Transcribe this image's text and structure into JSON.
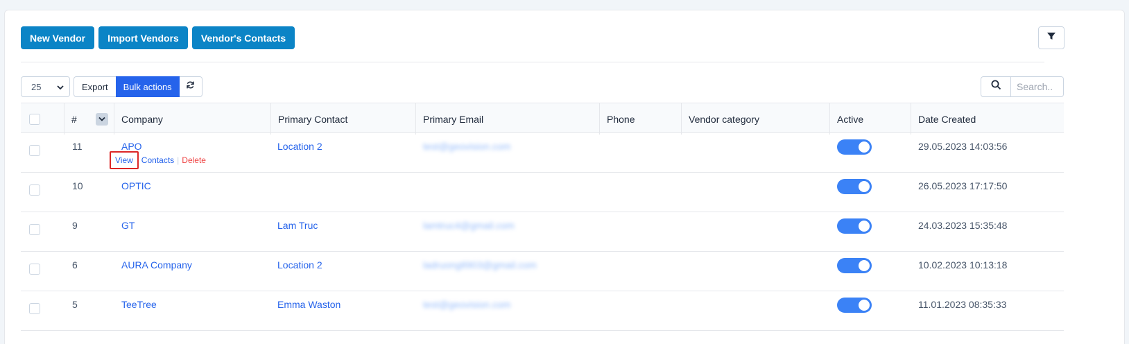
{
  "toolbar": {
    "new_vendor": "New Vendor",
    "import_vendors": "Import Vendors",
    "vendors_contacts": "Vendor's Contacts",
    "filter_icon": "filter-icon"
  },
  "table_controls": {
    "page_size": "25",
    "export": "Export",
    "bulk_actions": "Bulk actions",
    "reload_icon": "refresh-icon",
    "search_placeholder": "Search.."
  },
  "columns": {
    "num": "#",
    "company": "Company",
    "primary_contact": "Primary Contact",
    "primary_email": "Primary Email",
    "phone": "Phone",
    "vendor_category": "Vendor category",
    "active": "Active",
    "date_created": "Date Created"
  },
  "row_actions": {
    "view": "View",
    "contacts": "Contacts",
    "delete": "Delete"
  },
  "rows": [
    {
      "id": "11",
      "company": "APO",
      "contact": "Location 2",
      "email": "test@geovision.com",
      "phone": "",
      "category": "",
      "active": true,
      "date": "29.05.2023 14:03:56"
    },
    {
      "id": "10",
      "company": "OPTIC",
      "contact": "",
      "email": "",
      "phone": "",
      "category": "",
      "active": true,
      "date": "26.05.2023 17:17:50"
    },
    {
      "id": "9",
      "company": "GT",
      "contact": "Lam Truc",
      "email": "lamtruc4@gmail.com",
      "phone": "",
      "category": "",
      "active": true,
      "date": "24.03.2023 15:35:48"
    },
    {
      "id": "6",
      "company": "AURA Company",
      "contact": "Location 2",
      "email": "ladruong8903@gmail.com",
      "phone": "",
      "category": "",
      "active": true,
      "date": "10.02.2023 10:13:18"
    },
    {
      "id": "5",
      "company": "TeeTree",
      "contact": "Emma Waston",
      "email": "test@geovision.com",
      "phone": "",
      "category": "",
      "active": true,
      "date": "11.01.2023 08:35:33"
    }
  ],
  "colors": {
    "primary": "#0b84c6",
    "bulk": "#2563eb",
    "link": "#2563eb",
    "delete": "#ef4444",
    "toggle_on": "#3b82f6",
    "highlight": "#dc2626"
  }
}
